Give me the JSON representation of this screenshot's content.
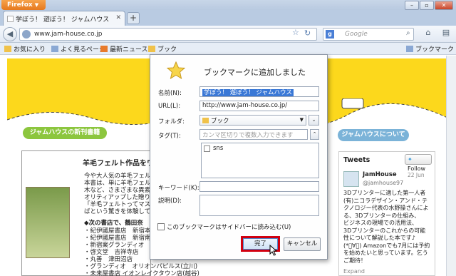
{
  "browser": {
    "app_button": "Firefox",
    "tab_title": "学ぼう！ 遊ぼう！ ジャムハウス",
    "new_tab": "+",
    "url": "www.jam-house.co.jp",
    "search_placeholder": "Google"
  },
  "bookmarks_bar": {
    "items": [
      "お気に入り",
      "よく見るページ",
      "最新ニュース",
      "ブック"
    ],
    "right_item": "ブックマーク"
  },
  "page": {
    "new_books_label": "ジャムハウスの新刊書籍",
    "about_label": "ジャムハウスについて",
    "book_title": "羊毛フェルト作品をワンラ",
    "book_lines": [
      "今や大人気の羊毛フェルト",
      "本書は、単に羊毛フェルト",
      "木など、さまざまな異素材",
      "オリティアップした贈り物",
      "「羊毛フェルトってマスコッ",
      "ばという驚きを体験してく"
    ],
    "stores_heading": "◆次の書店で、鶴田奈",
    "stores": [
      "・紀伊國屋書店　新宿本店",
      "・紀伊國屋書店　新宿南店",
      "・新宿案グランディオ　渋田",
      "・啓文堂　吉祥寺店",
      "・丸善　津田沼店",
      "・グランディオ　オリオンパピルス(立川)",
      "・未来屋書店 イオンレイクタウン店(越谷)"
    ],
    "tweets": {
      "heading": "Tweets",
      "follow_label": "Follow",
      "user_name": "JamHouse",
      "user_handle": "@jamhouse97",
      "date": "22 Jun",
      "body_lines": [
        "3Dプリンターに適した第一人者",
        "(有)ニコラデザイン・アンド・テ",
        "クノロジー代表の水野操さんによ",
        "る、3Dプリンターの仕組み、",
        "ビジネスの現場での活用法、",
        "3Dプリンターのこれからの可能",
        "性について解説した本です♪",
        "(*゚∀゚) Amazonでも7月には予約",
        "を始めたいと思っています。乞う",
        "ご期待！"
      ],
      "expand": "Expand"
    }
  },
  "dialog": {
    "title": "ブックマークに追加しました",
    "name_label": "名前(N):",
    "name_value": "学ぼう！ 遊ぼう！ ジャムハウス",
    "url_label": "URL(L):",
    "url_value": "http://www.jam-house.co.jp/",
    "folder_label": "フォルダ:",
    "folder_value": "ブック",
    "tags_label": "タグ(T):",
    "tags_placeholder": "カンマ区切りで複数入力できます",
    "tag_option": "sns",
    "keyword_label": "キーワード(K):",
    "description_label": "説明(D):",
    "sidebar_checkbox_label": "このブックマークはサイドバーに読み込む(U)",
    "done_button": "完了",
    "cancel_button": "キャンセル"
  },
  "colors": {
    "banner_yellow": "#fcd81c",
    "green_badge": "#8cc63e",
    "blue_badge": "#7bb3d8",
    "highlight_red": "#d40010",
    "selection_blue": "#3a78d6"
  }
}
